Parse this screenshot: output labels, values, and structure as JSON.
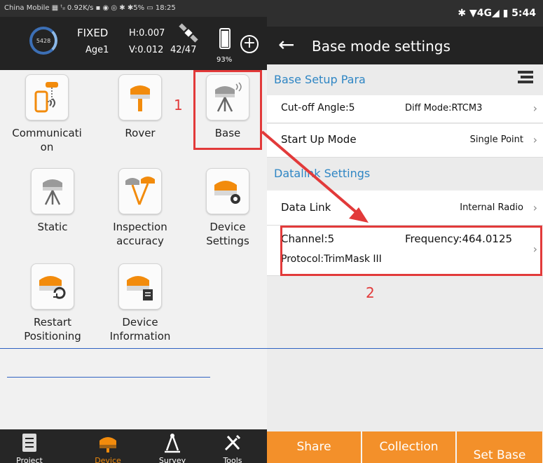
{
  "left": {
    "status_bar": "China Mobile ▦ ᵗᵢₗ 0.92K/s ▪ ◉  ◎ ✱ ✱5% ▭ 18:25",
    "header": {
      "ring_value": "5428",
      "fix_status": "FIXED",
      "age": "Age1",
      "h_precision": "H:0.007",
      "v_precision": "V:0.012",
      "satellites": "42/47",
      "battery": "93%"
    },
    "grid": [
      {
        "label": "Communicati\non"
      },
      {
        "label": "Rover"
      },
      {
        "label": "Base"
      },
      {
        "label": "Static"
      },
      {
        "label": "Inspection\naccuracy"
      },
      {
        "label": "Device\nSettings"
      },
      {
        "label": "Restart\nPositioning"
      },
      {
        "label": "Device\nInformation"
      }
    ],
    "callout_1": "1",
    "nav": [
      {
        "label": "Project"
      },
      {
        "label": "Device"
      },
      {
        "label": "Survey"
      },
      {
        "label": "Tools"
      }
    ],
    "accent": "#f28b0c"
  },
  "right": {
    "status_bar": "✱ ▼4G◢ ▮ 5:44",
    "title": "Base mode settings",
    "section1": "Base Setup Para",
    "cutoff": "Cut-off Angle:5",
    "diff_mode": "Diff Mode:RTCM3",
    "startup_label": "Start Up Mode",
    "startup_value": "Single Point",
    "section2": "Datalink Settings",
    "datalink_label": "Data Link",
    "datalink_value": "Internal Radio",
    "channel": "Channel:5",
    "frequency": "Frequency:464.0125",
    "protocol": "Protocol:TrimMask III",
    "callout_2": "2",
    "buttons": {
      "share": "Share",
      "collection": "Collection",
      "set_base": "Set Base\nStartup"
    },
    "accent": "#f3902a",
    "section_color": "#2f86c4"
  }
}
